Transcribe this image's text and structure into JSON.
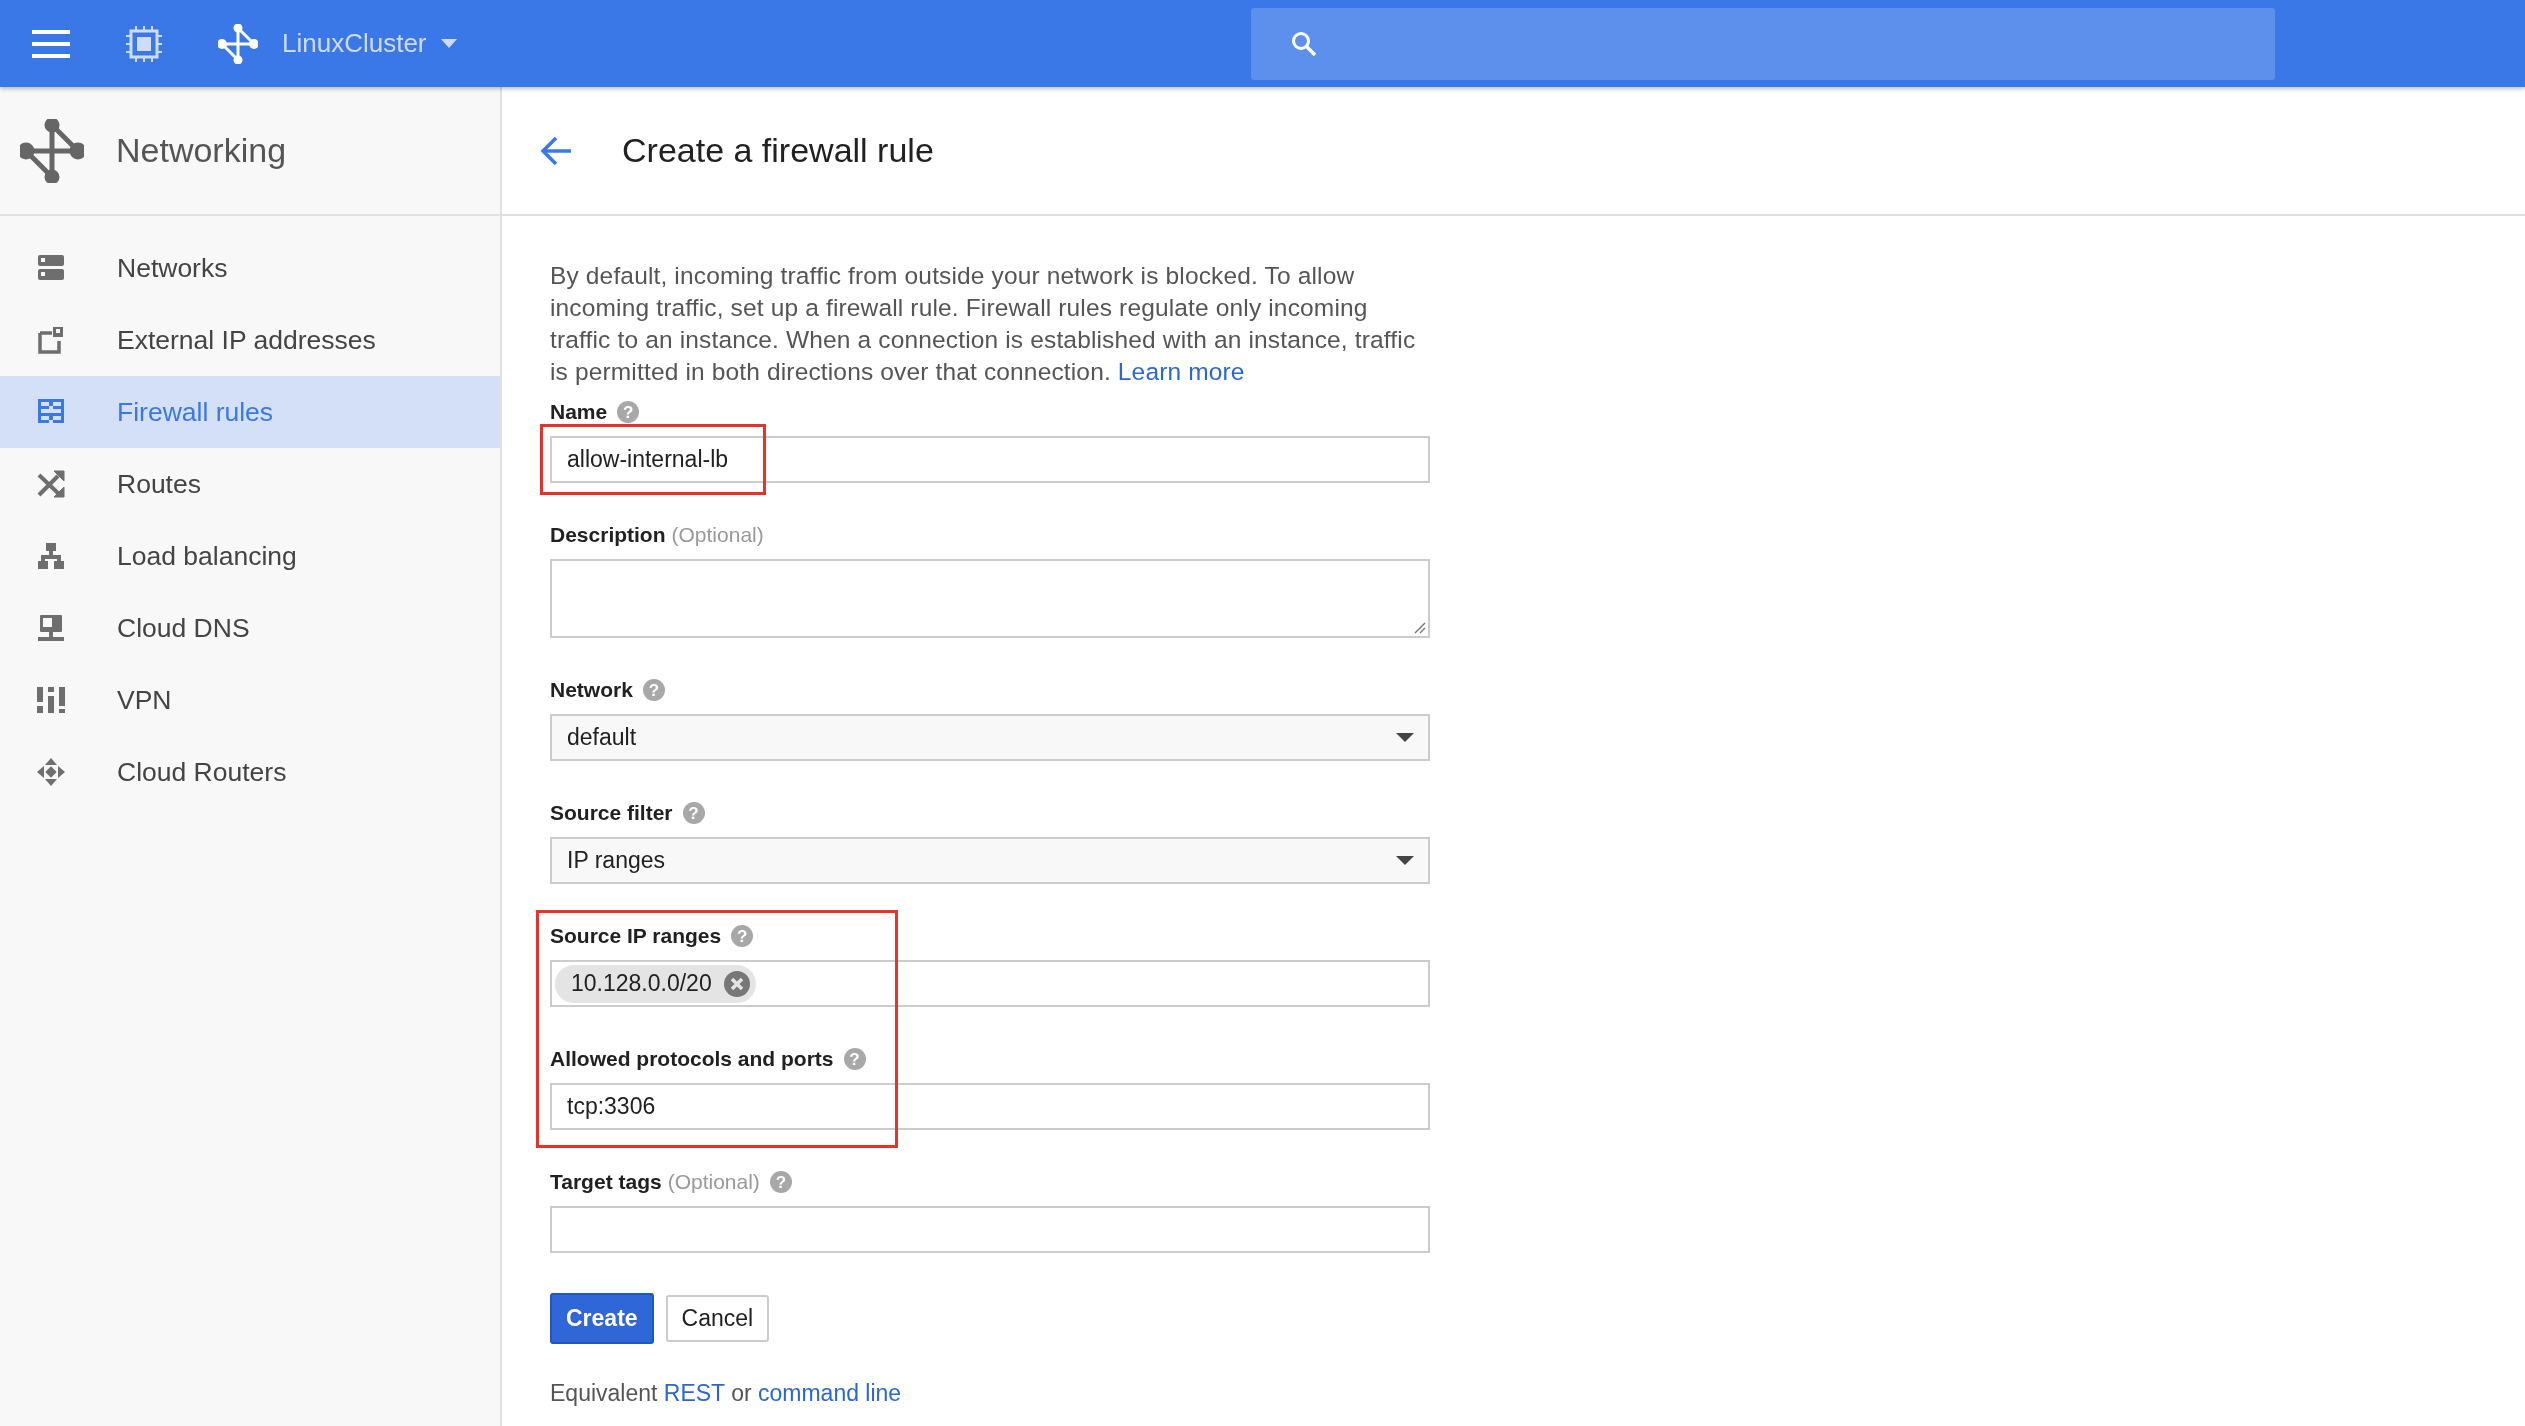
{
  "topbar": {
    "project": "LinuxCluster"
  },
  "sidebar": {
    "title": "Networking",
    "items": [
      {
        "label": "Networks",
        "selected": false
      },
      {
        "label": "External IP addresses",
        "selected": false
      },
      {
        "label": "Firewall rules",
        "selected": true
      },
      {
        "label": "Routes",
        "selected": false
      },
      {
        "label": "Load balancing",
        "selected": false
      },
      {
        "label": "Cloud DNS",
        "selected": false
      },
      {
        "label": "VPN",
        "selected": false
      },
      {
        "label": "Cloud Routers",
        "selected": false
      }
    ]
  },
  "page": {
    "title": "Create a firewall rule",
    "intro": "By default, incoming traffic from outside your network is blocked. To allow incoming traffic, set up a firewall rule. Firewall rules regulate only incoming traffic to an instance. When a connection is established with an instance, traffic is permitted in both directions over that connection.",
    "intro_link": "Learn more",
    "fields": [
      {
        "kind": "text",
        "label": "Name",
        "help": "?",
        "value": "allow-internal-lb",
        "outlined": true
      },
      {
        "kind": "textarea",
        "label": "Description",
        "optional": "(Optional)",
        "outlined": false
      },
      {
        "kind": "select",
        "label": "Network",
        "help": "?",
        "value": "default",
        "outlined": false
      },
      {
        "kind": "select",
        "label": "Source filter",
        "help": "?",
        "value": "IP ranges",
        "outlined": false
      },
      {
        "kind": "chips",
        "label": "Source IP ranges",
        "help": "?",
        "chips": [
          "10.128.0.0/20"
        ],
        "outlined": true
      },
      {
        "kind": "text",
        "label": "Allowed protocols and ports",
        "help": "?",
        "value": "tcp:3306",
        "outlined": true
      },
      {
        "kind": "text",
        "label": "Target tags",
        "optional": "(Optional)",
        "help": "?",
        "outlined": false
      }
    ],
    "buttons": [
      {
        "label": "Create",
        "kind": "primary"
      },
      {
        "label": "Cancel",
        "kind": "secondary"
      }
    ],
    "footer": {
      "prefix": "Equivalent",
      "link1": "REST",
      "middle": "or",
      "link2": "command line"
    }
  }
}
